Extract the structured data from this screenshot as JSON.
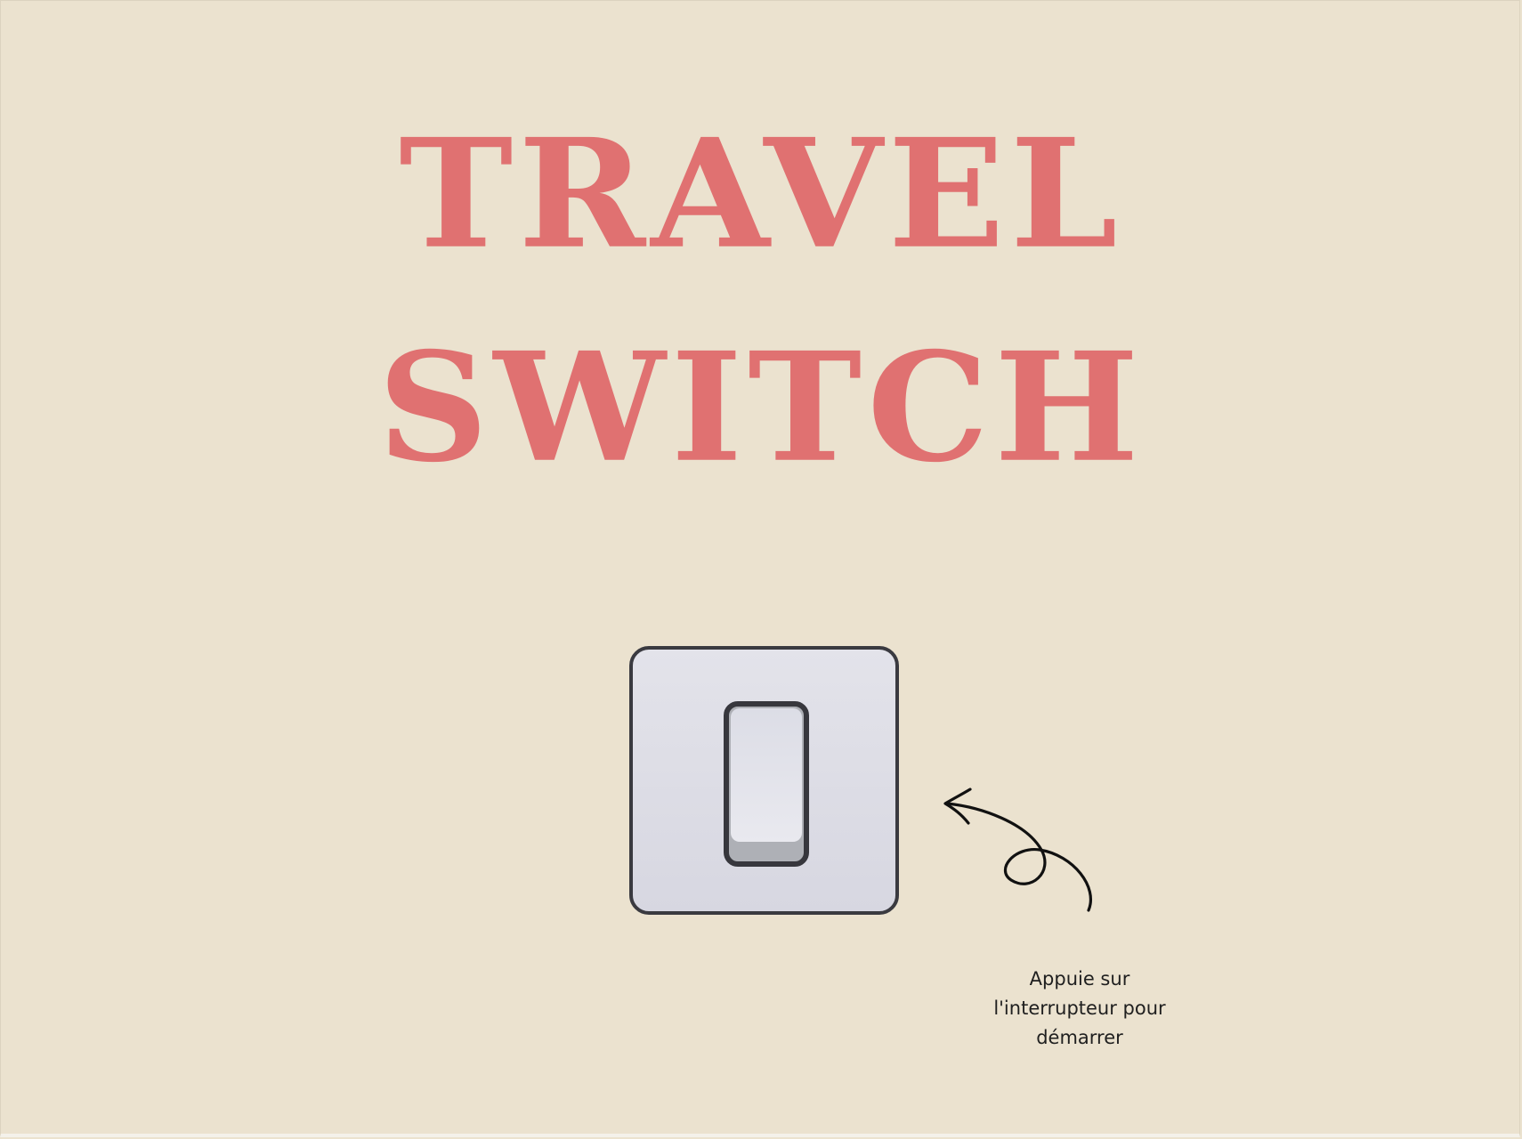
{
  "title": {
    "line1": "TRAVEL",
    "line2": "SWITCH"
  },
  "switch": {
    "state": "off"
  },
  "hint": {
    "line1": "Appuie sur",
    "line2": "l'interrupteur pour",
    "line3": "démarrer"
  },
  "icons": {
    "arrow": "curly-arrow-icon"
  },
  "colors": {
    "background": "#ebe2cf",
    "title": "#e07171",
    "switch_border": "#3a3a40",
    "switch_face": "#e3e3ea",
    "text": "#1f1f1f"
  }
}
